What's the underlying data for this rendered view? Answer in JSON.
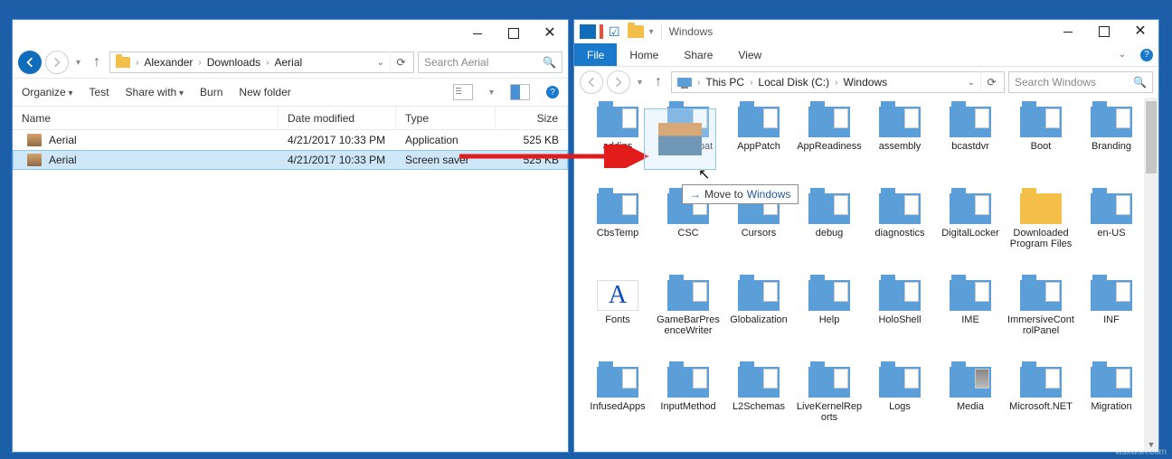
{
  "left": {
    "breadcrumb": [
      "Alexander",
      "Downloads",
      "Aerial"
    ],
    "search_placeholder": "Search Aerial",
    "toolbar": {
      "organize": "Organize",
      "test": "Test",
      "share": "Share with",
      "burn": "Burn",
      "newfolder": "New folder"
    },
    "headers": {
      "name": "Name",
      "modified": "Date modified",
      "type": "Type",
      "size": "Size"
    },
    "rows": [
      {
        "name": "Aerial",
        "modified": "4/21/2017 10:33 PM",
        "type": "Application",
        "size": "525 KB",
        "selected": false
      },
      {
        "name": "Aerial",
        "modified": "4/21/2017 10:33 PM",
        "type": "Screen saver",
        "size": "525 KB",
        "selected": true
      }
    ]
  },
  "right": {
    "title": "Windows",
    "ribbon": {
      "file": "File",
      "home": "Home",
      "share": "Share",
      "view": "View"
    },
    "breadcrumb": [
      "This PC",
      "Local Disk (C:)",
      "Windows"
    ],
    "search_placeholder": "Search Windows",
    "folders": [
      "addins",
      "appcompat",
      "AppPatch",
      "AppReadiness",
      "assembly",
      "bcastdvr",
      "Boot",
      "Branding",
      "CbsTemp",
      "CSC",
      "Cursors",
      "debug",
      "diagnostics",
      "DigitalLocker",
      "Downloaded Program Files",
      "en-US",
      "Fonts",
      "GameBarPresenceWriter",
      "Globalization",
      "Help",
      "HoloShell",
      "IME",
      "ImmersiveControlPanel",
      "INF",
      "InfusedApps",
      "InputMethod",
      "L2Schemas",
      "LiveKernelReports",
      "Logs",
      "Media",
      "Microsoft.NET",
      "Migration"
    ],
    "move_tip_prefix": "Move to",
    "move_tip_target": "Windows"
  },
  "watermark": "wsxwsn.com"
}
